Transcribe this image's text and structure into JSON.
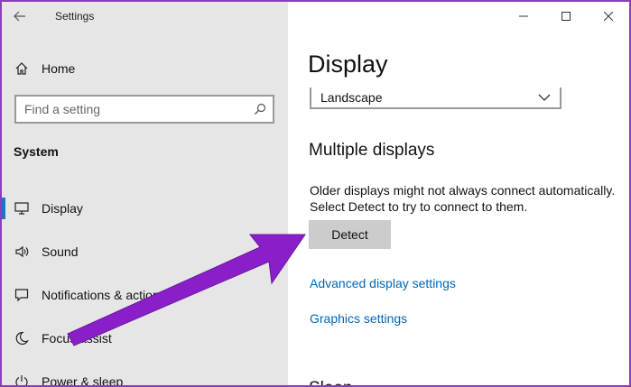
{
  "window": {
    "title": "Settings",
    "controls": [
      "minimize",
      "maximize",
      "close"
    ]
  },
  "sidebar": {
    "home_label": "Home",
    "search": {
      "placeholder": "Find a setting",
      "value": ""
    },
    "section_label": "System",
    "items": [
      {
        "label": "Display",
        "icon": "monitor-icon",
        "active": true
      },
      {
        "label": "Sound",
        "icon": "speaker-icon",
        "active": false
      },
      {
        "label": "Notifications & actions",
        "icon": "notification-icon",
        "active": false
      },
      {
        "label": "Focus assist",
        "icon": "moon-icon",
        "active": false
      },
      {
        "label": "Power & sleep",
        "icon": "power-icon",
        "active": false
      }
    ]
  },
  "main": {
    "page_title": "Display",
    "orientation_value": "Landscape",
    "multiple_displays_heading": "Multiple displays",
    "description_line1": "Older displays might not always connect automatically.",
    "description_line2": "Select Detect to try to connect to them.",
    "detect_button": "Detect",
    "advanced_link": "Advanced display settings",
    "graphics_link": "Graphics settings",
    "next_heading_partial": "Sleep"
  },
  "colors": {
    "accent": "#2670c8",
    "link": "#0067b8",
    "sidebar_bg": "#e6e6e6",
    "annotation_arrow": "#8a1fc9",
    "frame": "#8a3fb8"
  }
}
